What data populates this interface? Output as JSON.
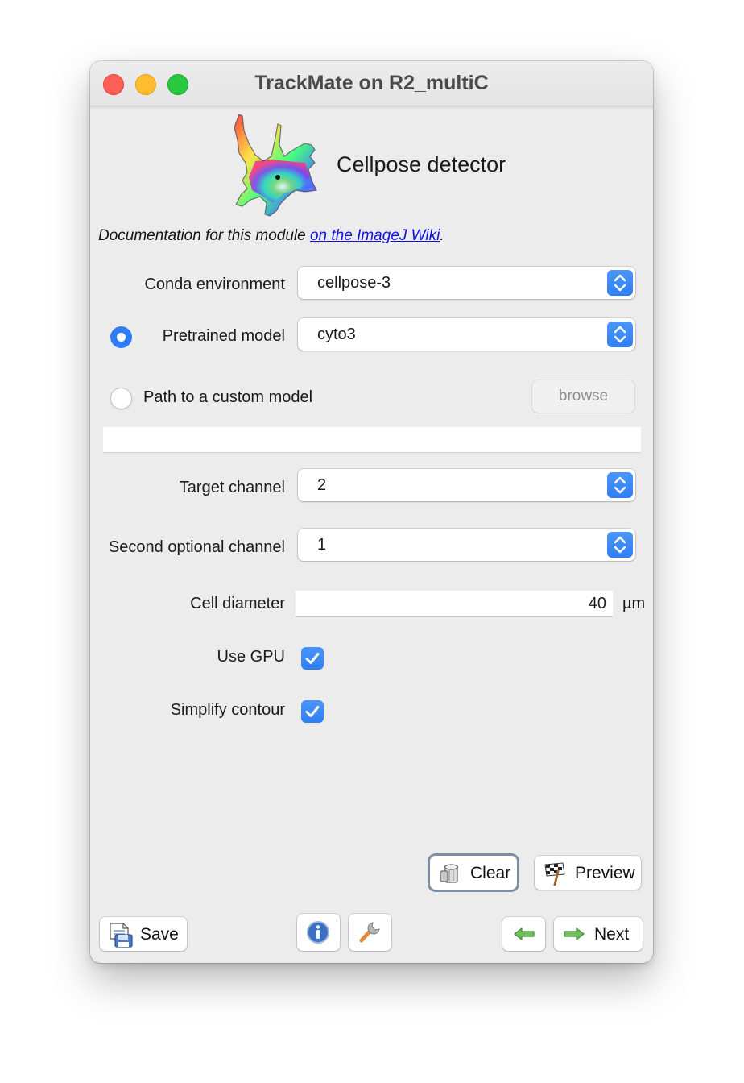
{
  "window": {
    "title": "TrackMate on R2_multiC"
  },
  "header": {
    "heading": "Cellpose detector"
  },
  "documentation": {
    "prefix": "Documentation for this module ",
    "link_text": "on the ImageJ Wiki",
    "suffix": "."
  },
  "conda": {
    "label": "Conda environment",
    "value": "cellpose-3"
  },
  "pretrained": {
    "label": "Pretrained model",
    "value": "cyto3",
    "selected": true
  },
  "custom_model": {
    "label": "Path to a custom model",
    "browse_label": "browse",
    "path_value": "",
    "selected": false
  },
  "target_channel": {
    "label": "Target channel",
    "value": "2"
  },
  "second_channel": {
    "label": "Second optional channel",
    "value": "1"
  },
  "cell_diameter": {
    "label": "Cell diameter",
    "value": "40",
    "unit": "µm"
  },
  "use_gpu": {
    "label": "Use GPU",
    "checked": true
  },
  "simplify_contour": {
    "label": "Simplify contour",
    "checked": true
  },
  "actions": {
    "clear_label": "Clear",
    "preview_label": "Preview"
  },
  "footer": {
    "save_label": "Save",
    "next_label": "Next"
  },
  "colors": {
    "accent": "#2f7ef3",
    "link": "#1010d8",
    "close": "#fe5f57",
    "minimize": "#febc2e",
    "maximize": "#28c840"
  },
  "icons": [
    "cellpose-logo-icon",
    "updown-arrows-icon",
    "checkmark-icon",
    "trash-can-icon",
    "checkered-flag-icon",
    "save-icon",
    "info-icon",
    "wrench-icon",
    "back-arrow-icon",
    "next-arrow-icon"
  ]
}
